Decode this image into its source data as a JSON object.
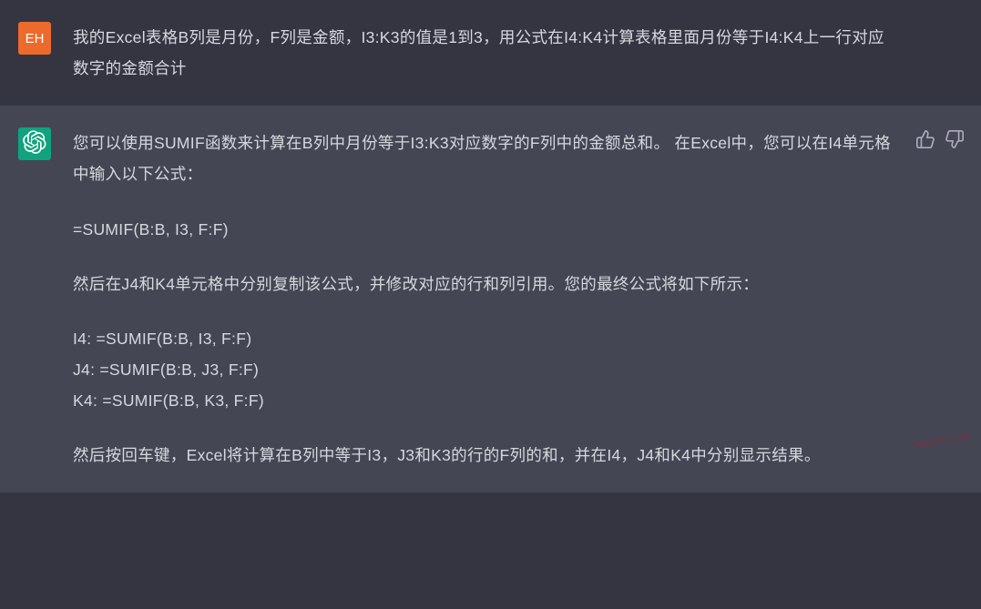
{
  "user": {
    "avatar_text": "EH",
    "message": "我的Excel表格B列是月份，F列是金额，I3:K3的值是1到3，用公式在I4:K4计算表格里面月份等于I4:K4上一行对应数字的金额合计"
  },
  "assistant": {
    "p1": "您可以使用SUMIF函数来计算在B列中月份等于I3:K3对应数字的F列中的金额总和。 在Excel中，您可以在I4单元格中输入以下公式：",
    "p2": "=SUMIF(B:B, I3, F:F)",
    "p3": "然后在J4和K4单元格中分别复制该公式，并修改对应的行和列引用。您的最终公式将如下所示：",
    "p4_l1": "I4: =SUMIF(B:B, I3, F:F)",
    "p4_l2": "J4: =SUMIF(B:B, J3, F:F)",
    "p4_l3": "K4: =SUMIF(B:B, K3, F:F)",
    "p5": "然后按回车键，Excel将计算在B列中等于I3，J3和K3的行的F列的和，并在I4，J4和K4中分别显示结果。"
  },
  "watermark": "7aucn.com"
}
